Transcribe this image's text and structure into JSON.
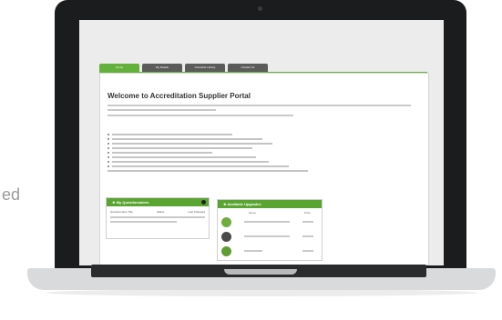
{
  "side_text": "ed",
  "tabs": [
    {
      "label": "Home"
    },
    {
      "label": "My Details"
    },
    {
      "label": "Contracts Library"
    },
    {
      "label": "Contact Us"
    }
  ],
  "main": {
    "title": "Welcome to Accreditation Supplier Portal"
  },
  "panels": {
    "questionnaires": {
      "title": "My Questionnaires",
      "col_questionnaire": "Questionnaire Title",
      "col_status": "Status",
      "col_last_changed": "Last Changed"
    },
    "upgrades": {
      "title": "Available Upgrades",
      "col_name": "Name",
      "col_price": "Price"
    }
  }
}
